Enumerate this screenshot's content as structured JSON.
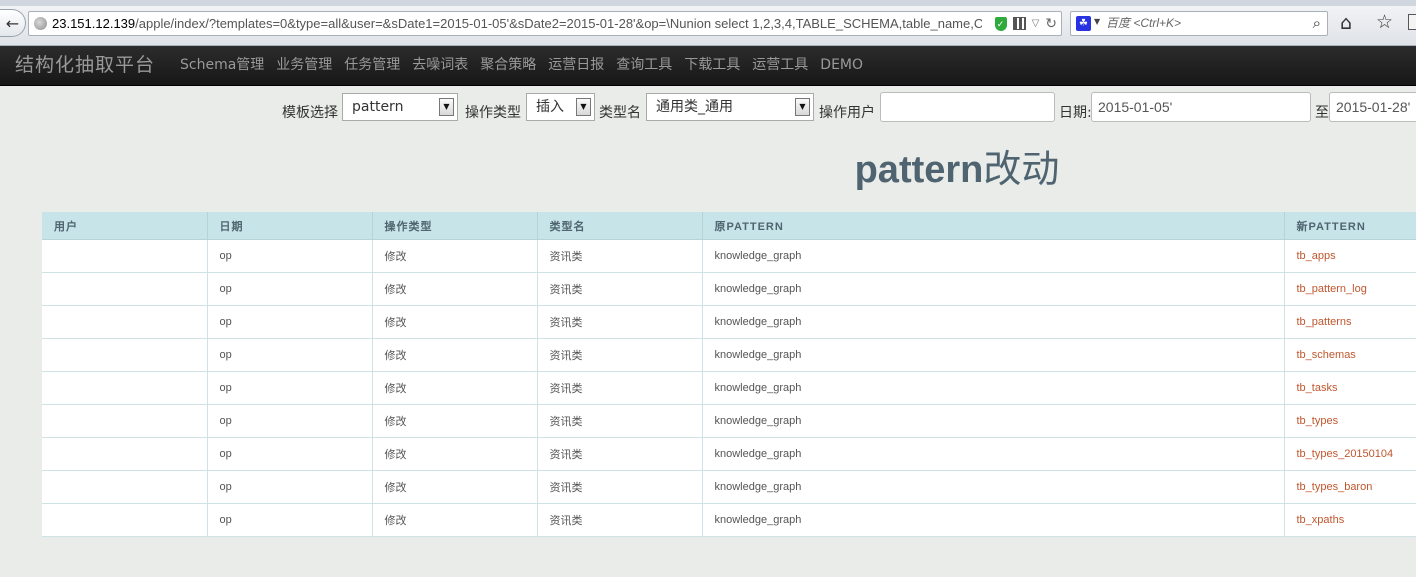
{
  "browser": {
    "url_host": "23.151.12.139",
    "url_rest": "/apple/index/?templates=0&type=all&user=&sDate1=2015-01-05'&sDate2=2015-01-28'&op=\\Nunion select 1,2,3,4,TABLE_SCHEMA,table_name,C",
    "search_placeholder": "百度 <Ctrl+K>",
    "icons": [
      "back-arrow-icon",
      "globe-icon",
      "shield-icon",
      "qr-code-icon",
      "reload-icon",
      "baidu-icon",
      "magnifier-icon",
      "home-icon",
      "star-icon"
    ]
  },
  "navbar": {
    "brand": "结构化抽取平台",
    "items": [
      "Schema管理",
      "业务管理",
      "任务管理",
      "去噪词表",
      "聚合策略",
      "运营日报",
      "查询工具",
      "下载工具",
      "运营工具",
      "DEMO"
    ]
  },
  "filters": {
    "template_label": "模板选择",
    "template_value": "pattern",
    "op_type_label": "操作类型",
    "op_type_value": "插入",
    "type_name_label": "类型名",
    "type_name_value": "通用类_通用",
    "user_label": "操作用户",
    "user_value": "",
    "date_label": "日期:",
    "date_from": "2015-01-05'",
    "date_to_label": "至",
    "date_to": "2015-01-28'"
  },
  "title": {
    "main": "pattern",
    "suffix": "改动"
  },
  "table": {
    "headers": [
      "用户",
      "日期",
      "操作类型",
      "类型名",
      "原PATTERN",
      "新PATTERN"
    ],
    "rows": [
      [
        "",
        "op",
        "修改",
        "资讯类",
        "knowledge_graph",
        "tb_apps"
      ],
      [
        "",
        "op",
        "修改",
        "资讯类",
        "knowledge_graph",
        "tb_pattern_log"
      ],
      [
        "",
        "op",
        "修改",
        "资讯类",
        "knowledge_graph",
        "tb_patterns"
      ],
      [
        "",
        "op",
        "修改",
        "资讯类",
        "knowledge_graph",
        "tb_schemas"
      ],
      [
        "",
        "op",
        "修改",
        "资讯类",
        "knowledge_graph",
        "tb_tasks"
      ],
      [
        "",
        "op",
        "修改",
        "资讯类",
        "knowledge_graph",
        "tb_types"
      ],
      [
        "",
        "op",
        "修改",
        "资讯类",
        "knowledge_graph",
        "tb_types_20150104"
      ],
      [
        "",
        "op",
        "修改",
        "资讯类",
        "knowledge_graph",
        "tb_types_baron"
      ],
      [
        "",
        "op",
        "修改",
        "资讯类",
        "knowledge_graph",
        "tb_xpaths"
      ]
    ]
  },
  "colors": {
    "navbar_bg": "#1b1b1b",
    "table_header_bg": "#c7e5e9",
    "link": "#c0572e",
    "title": "#4f6470"
  }
}
